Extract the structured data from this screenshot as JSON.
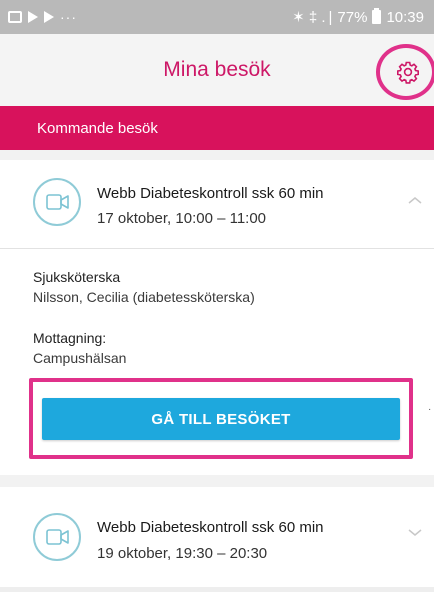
{
  "status_bar": {
    "dots": "···",
    "signal_text": "✶ ‡ . |",
    "battery_percent": "77%",
    "time": "10:39"
  },
  "header": {
    "title": "Mina besök",
    "settings_icon": "gear-icon"
  },
  "section": {
    "title": "Kommande besök"
  },
  "visits": [
    {
      "title": "Webb Diabeteskontroll ssk 60 min",
      "time": "17 oktober, 10:00 – 11:00",
      "icon": "video-camera-icon",
      "expanded": true
    },
    {
      "title": "Webb Diabeteskontroll ssk 60 min",
      "time": "19 oktober, 19:30 – 20:30",
      "icon": "video-camera-icon",
      "expanded": false
    }
  ],
  "details": {
    "role_label": "Sjuksköterska",
    "role_value": "Nilsson, Cecilia (diabetessköterska)",
    "clinic_label": "Mottagning:",
    "clinic_value": "Campushälsan",
    "join_button": "GÅ TILL BESÖKET"
  },
  "colors": {
    "accent": "#cd1867",
    "section_bar": "#d8125c",
    "button": "#1ea8dd",
    "highlight": "#e0318a"
  }
}
